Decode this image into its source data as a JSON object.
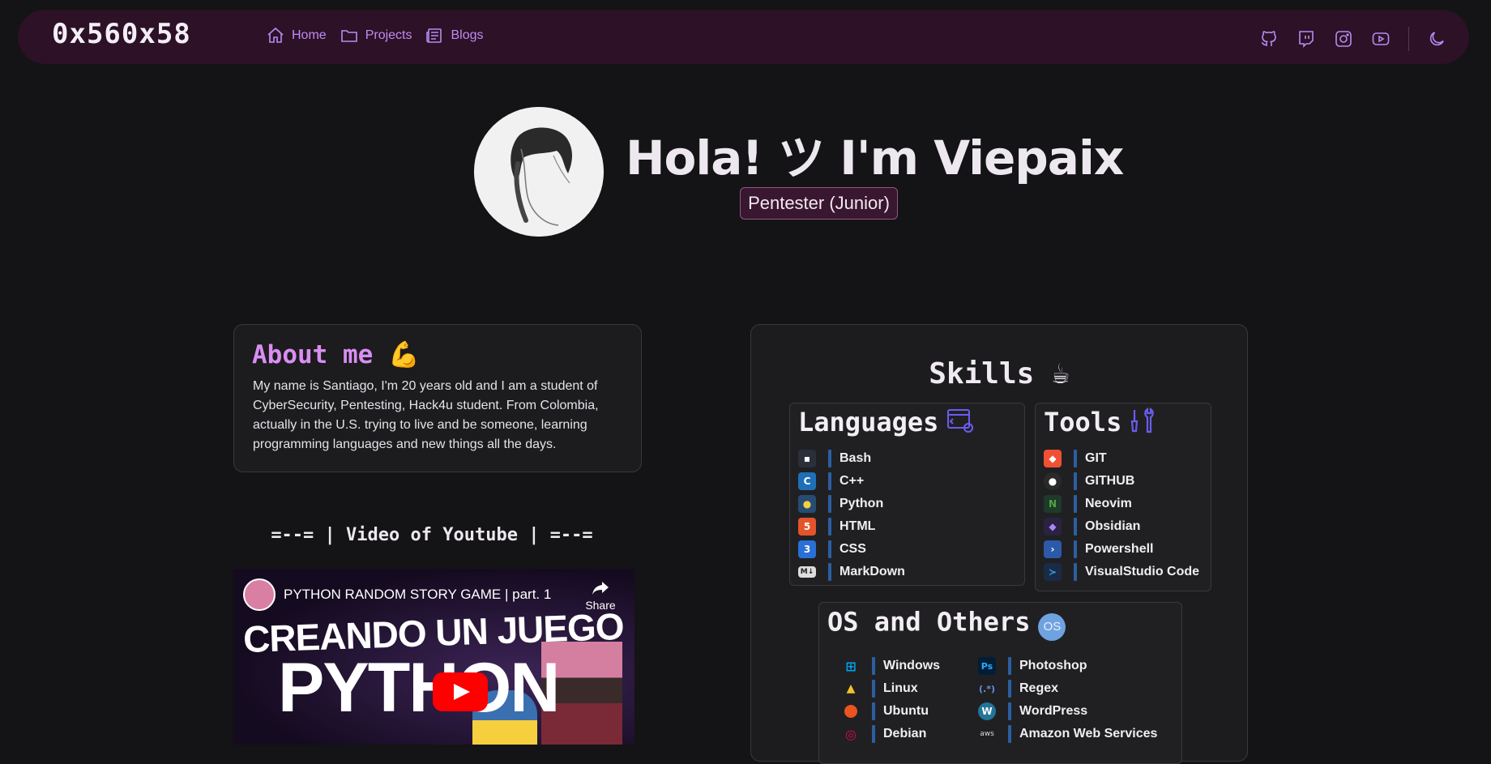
{
  "nav": {
    "brand": "0x560x58",
    "links": [
      {
        "label": "Home",
        "icon": "home-icon"
      },
      {
        "label": "Projects",
        "icon": "folder-icon"
      },
      {
        "label": "Blogs",
        "icon": "newspaper-icon"
      }
    ],
    "social": [
      "github-icon",
      "twitch-icon",
      "instagram-icon",
      "youtube-icon"
    ],
    "theme_icon": "moon-icon"
  },
  "hero": {
    "greeting": "Hola! ツ I'm Viepaix",
    "role": "Pentester (Junior)"
  },
  "about": {
    "title": "About me",
    "text": "My name is Santiago, I'm 20 years old and I am a student of CyberSecurity, Pentesting, Hack4u student. From Colombia, actually in the U.S. trying to live and be someone, learning programming languages and new things all the days."
  },
  "video": {
    "heading": "=--= | Video of Youtube | =--=",
    "title": "PYTHON RANDOM STORY GAME | part. 1",
    "share_label": "Share",
    "thumb_line1": "CREANDO UN JUEGO",
    "thumb_line2": "PYTHON"
  },
  "skills": {
    "title": "Skills",
    "languages": {
      "title": "Languages",
      "items": [
        "Bash",
        "C++",
        "Python",
        "HTML",
        "CSS",
        "MarkDown"
      ]
    },
    "tools": {
      "title": "Tools",
      "items": [
        "GIT",
        "GITHUB",
        "Neovim",
        "Obsidian",
        "Powershell",
        "VisualStudio Code"
      ]
    },
    "os": {
      "title": "OS and Others",
      "badge": "OS",
      "col1": [
        "Windows",
        "Linux",
        "Ubuntu",
        "Debian"
      ],
      "col2": [
        "Photoshop",
        "Regex",
        "WordPress",
        "Amazon Web Services"
      ]
    }
  },
  "colors": {
    "accent": "#c08bf0",
    "nav_bg": "#2c1127",
    "about_title": "#d98ef2",
    "list_bar": "#2b5fa2"
  }
}
